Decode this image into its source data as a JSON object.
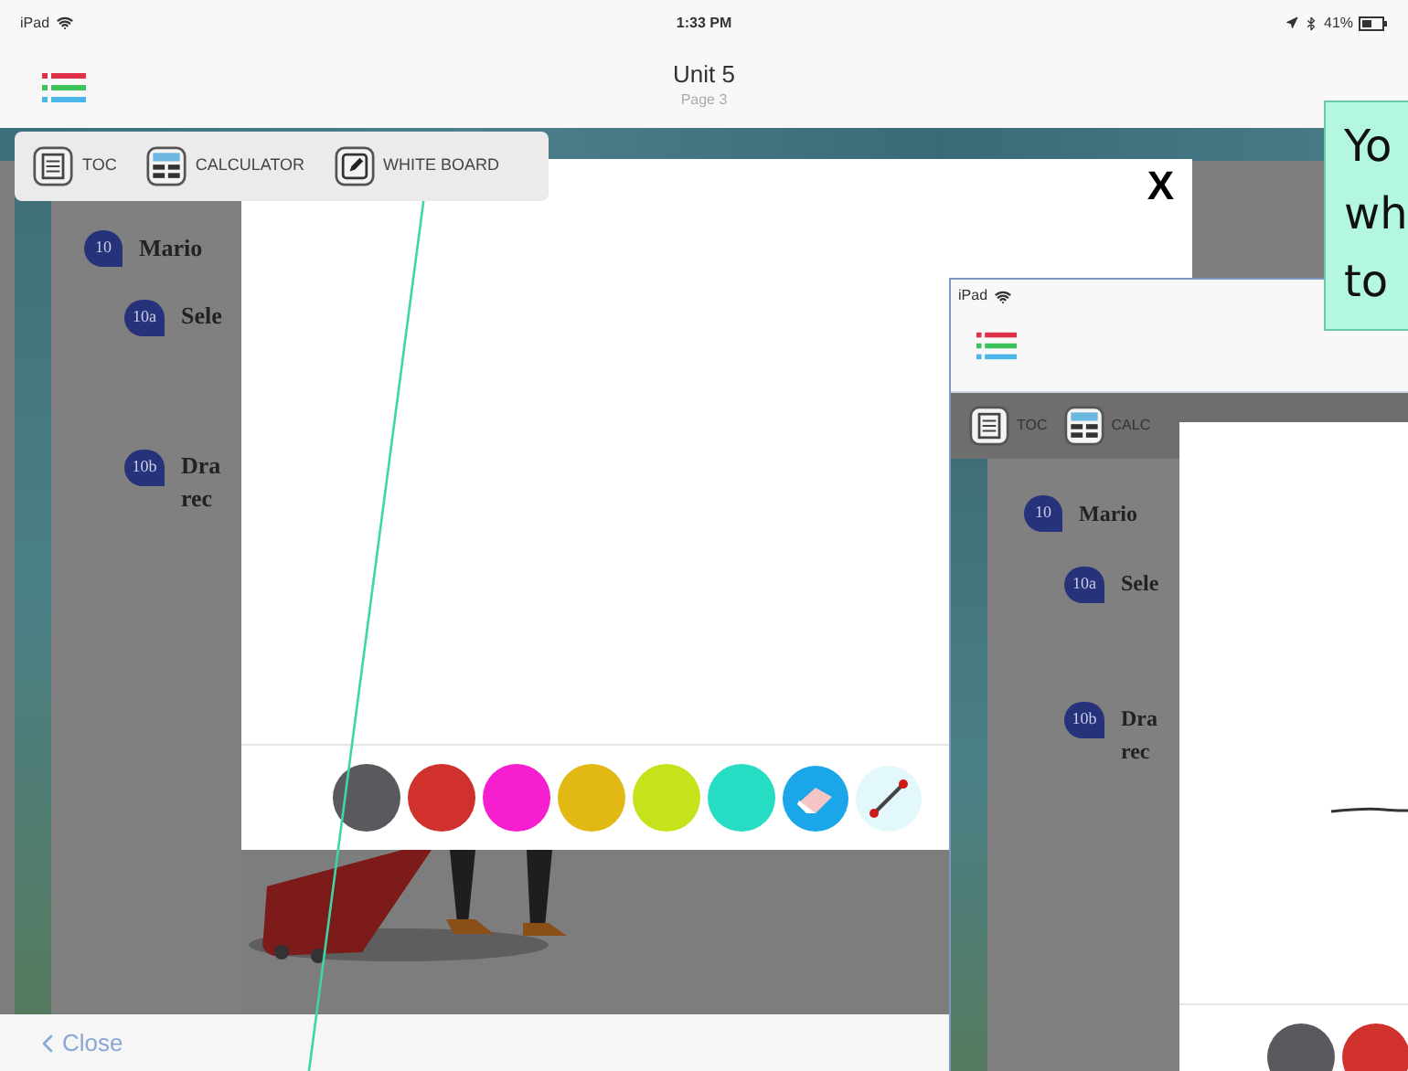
{
  "main_screen": {
    "status_bar": {
      "carrier": "iPad",
      "time": "1:33 PM",
      "battery": "41%"
    },
    "header": {
      "title": "Unit 5",
      "subtitle": "Page 3"
    },
    "toolbar": [
      {
        "kind": "toc",
        "label": "TOC"
      },
      {
        "kind": "calculator",
        "label": "CALCULATOR"
      },
      {
        "kind": "whiteboard",
        "label": "WHITE BOARD"
      }
    ],
    "questions": [
      {
        "number": "10",
        "lines": [
          "Mario"
        ],
        "children": [
          {
            "number": "10a",
            "lines": [
              "Sele"
            ]
          },
          {
            "number": "10b",
            "lines": [
              "Dra",
              "rec"
            ]
          }
        ]
      }
    ],
    "close_button": "Close",
    "whiteboard": {
      "close": "X",
      "colors": [
        {
          "color": "#5a5a5e"
        },
        {
          "color": "#d0312d"
        },
        {
          "color": "#f61fcf"
        },
        {
          "color": "#e2b814"
        },
        {
          "color": "#c6e21a"
        },
        {
          "color": "#26dcc3"
        }
      ],
      "tools": [
        {
          "kind": "eraser"
        },
        {
          "kind": "line"
        }
      ]
    }
  },
  "callout": {
    "lines": [
      "Yo",
      "wh",
      "to"
    ]
  },
  "inset_screen": {
    "status_bar": {
      "carrier": "iPad"
    },
    "toolbar": [
      {
        "kind": "toc",
        "label": "TOC"
      },
      {
        "kind": "calculator",
        "label": "CALC"
      }
    ],
    "questions": [
      {
        "number": "10",
        "lines": [
          "Mario"
        ],
        "children": [
          {
            "number": "10a",
            "lines": [
              "Sele"
            ]
          },
          {
            "number": "10b",
            "lines": [
              "Dra",
              "rec"
            ]
          }
        ]
      }
    ],
    "whiteboard": {
      "colors": [
        {
          "color": "#5a5a5e"
        },
        {
          "color": "#d0312d"
        }
      ]
    }
  }
}
